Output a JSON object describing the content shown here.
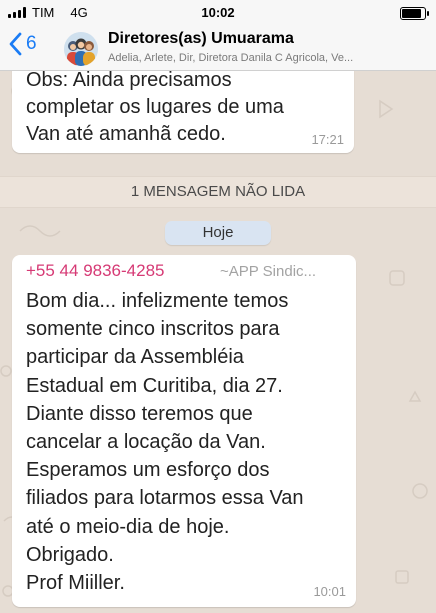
{
  "status_bar": {
    "carrier": "TIM",
    "network": "4G",
    "time": "10:02",
    "battery_level": 0.85
  },
  "header": {
    "back_count": "6",
    "chat_title": "Diretores(as) Umuarama",
    "participants": "Adelia, Arlete, Dir, Diretora Danila C Agricola, Ve..."
  },
  "messages": [
    {
      "lines": [
        "Obs: Ainda precisamos",
        "completar os lugares de uma",
        "Van até amanhã cedo."
      ],
      "time": "17:21"
    },
    {
      "sender_phone": "+55 44 9836-4285",
      "sender_name": "~APP Sindic...",
      "lines": [
        "Bom dia... infelizmente temos",
        "somente cinco inscritos para",
        "participar da Assembléia",
        "Estadual em Curitiba, dia 27.",
        "Diante disso teremos que",
        "cancelar a locação da Van.",
        "Esperamos um esforço dos",
        "filiados para lotarmos essa Van",
        "até o meio-dia de hoje.",
        "Obrigado.",
        "Prof Miiller."
      ],
      "time": "10:01"
    }
  ],
  "unread_banner": "1 MENSAGEM NÃO LIDA",
  "date_chip": "Hoje",
  "colors": {
    "ios_blue": "#1a7cf5",
    "sender_pink": "#d63a75",
    "chat_background": "#e6ddd4",
    "date_chip": "#d9e4f2"
  }
}
